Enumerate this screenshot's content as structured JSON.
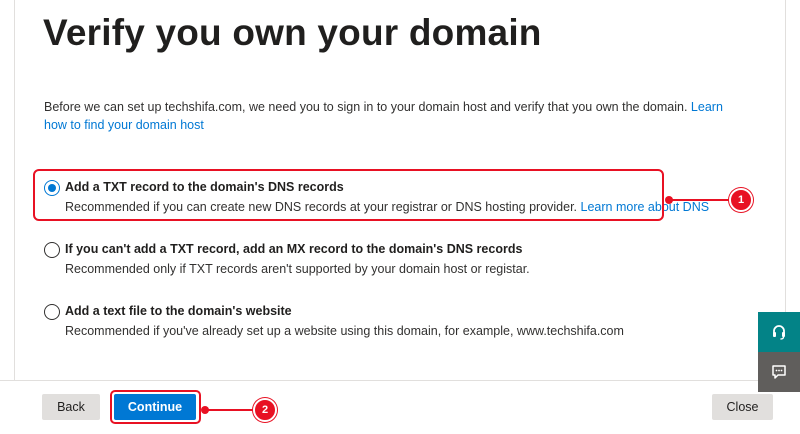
{
  "page": {
    "title": "Verify you own your domain",
    "intro_text": "Before we can set up techshifa.com, we need you to sign in to your domain host and verify that you own the domain.",
    "intro_link": "Learn how to find your domain host"
  },
  "options": [
    {
      "label": "Add a TXT record to the domain's DNS records",
      "description": "Recommended if you can create new DNS records at your registrar or DNS hosting provider.",
      "link": "Learn more about DNS",
      "checked": true
    },
    {
      "label": "If you can't add a TXT record, add an MX record to the domain's DNS records",
      "description": "Recommended only if TXT records aren't supported by your domain host or registar.",
      "checked": false
    },
    {
      "label": "Add a text file to the domain's website",
      "description": "Recommended if you've already set up a website using this domain, for example, www.techshifa.com",
      "checked": false
    }
  ],
  "annotations": {
    "step1": "1",
    "step2": "2",
    "color": "#e81123"
  },
  "footer": {
    "back_label": "Back",
    "continue_label": "Continue",
    "close_label": "Close"
  },
  "side_panel": {
    "top_icon": "headset-icon",
    "bottom_icon": "chat-feedback-icon"
  },
  "colors": {
    "accent": "#0078d4",
    "annotation": "#e81123",
    "side_top": "#038387",
    "side_bottom": "#605e5c"
  }
}
